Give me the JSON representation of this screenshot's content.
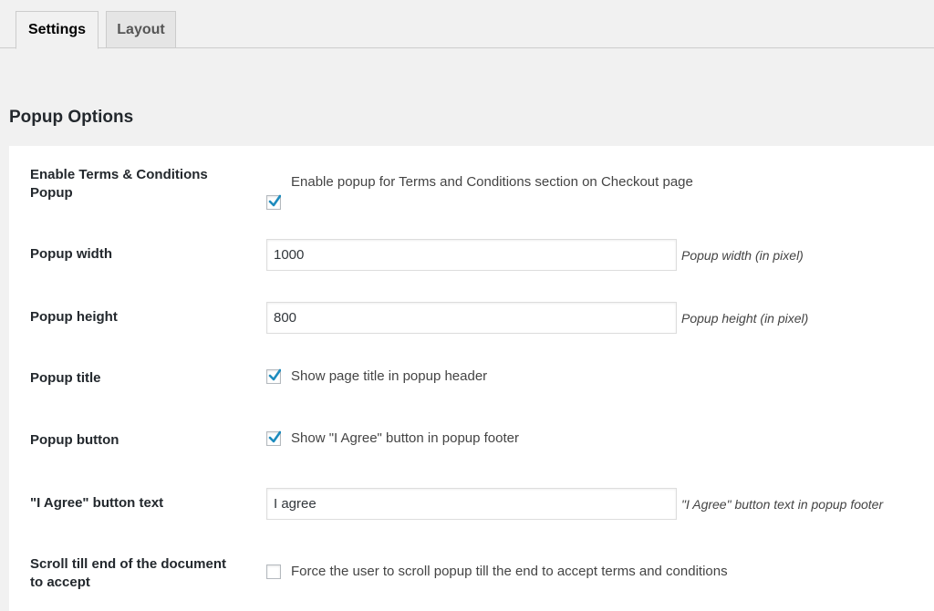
{
  "tabs": [
    {
      "label": "Settings",
      "active": true
    },
    {
      "label": "Layout",
      "active": false
    }
  ],
  "section_title": "Popup Options",
  "rows": {
    "enable": {
      "label": "Enable Terms & Conditions Popup",
      "checked": true,
      "checkbox_text": "Enable popup for Terms and Conditions section on Checkout page"
    },
    "width": {
      "label": "Popup width",
      "value": "1000",
      "description": "Popup width (in pixel)"
    },
    "height": {
      "label": "Popup height",
      "value": "800",
      "description": "Popup height (in pixel)"
    },
    "title": {
      "label": "Popup title",
      "checked": true,
      "checkbox_text": "Show page title in popup header"
    },
    "button": {
      "label": "Popup button",
      "checked": true,
      "checkbox_text": "Show \"I Agree\" button in popup footer"
    },
    "button_text": {
      "label": "\"I Agree\" button text",
      "value": "I agree",
      "description": "\"I Agree\" button text in popup footer"
    },
    "scroll": {
      "label": "Scroll till end of the document to accept",
      "checked": false,
      "checkbox_text": "Force the user to scroll popup till the end to accept terms and conditions"
    }
  },
  "colors": {
    "background": "#f1f1f1",
    "panel": "#ffffff",
    "checkmark": "#1e8cbe",
    "label_text": "#23282d"
  },
  "icons": {
    "checkmark": "checkmark-icon"
  }
}
